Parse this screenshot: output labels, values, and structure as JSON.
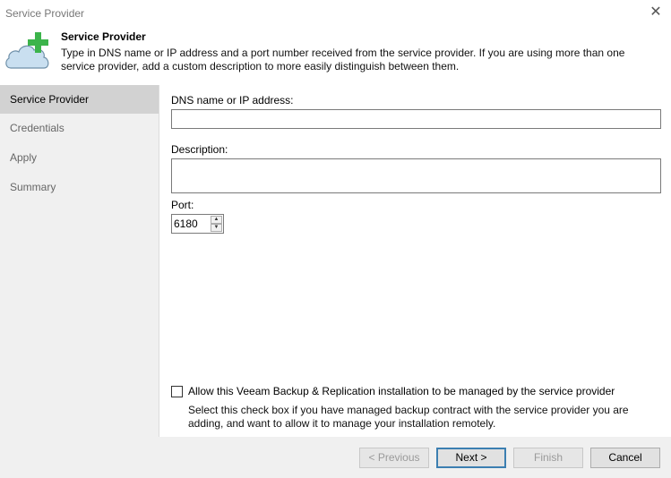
{
  "window": {
    "title": "Service Provider",
    "close_icon": "close-icon"
  },
  "header": {
    "title": "Service Provider",
    "description": "Type in DNS name or IP address and a port number received from the service provider. If you are using more than one service provider, add a custom description to more easily distinguish between them.",
    "icon": "cloud-plus-icon",
    "colors": {
      "cloud": "#c9dff0",
      "plus": "#3cb44b"
    }
  },
  "steps": [
    {
      "label": "Service Provider",
      "active": true
    },
    {
      "label": "Credentials",
      "active": false
    },
    {
      "label": "Apply",
      "active": false
    },
    {
      "label": "Summary",
      "active": false
    }
  ],
  "form": {
    "dns_label": "DNS name or IP address:",
    "dns_value": "",
    "description_label": "Description:",
    "description_value": "",
    "port_label": "Port:",
    "port_value": "6180",
    "checkbox_label": "Allow this Veeam Backup & Replication installation to be managed by the service provider",
    "checkbox_checked": false,
    "checkbox_help": "Select this check box if you have managed backup contract with the service provider you are adding, and want to allow it to manage your installation remotely."
  },
  "buttons": {
    "previous": "< Previous",
    "next": "Next >",
    "finish": "Finish",
    "cancel": "Cancel"
  }
}
